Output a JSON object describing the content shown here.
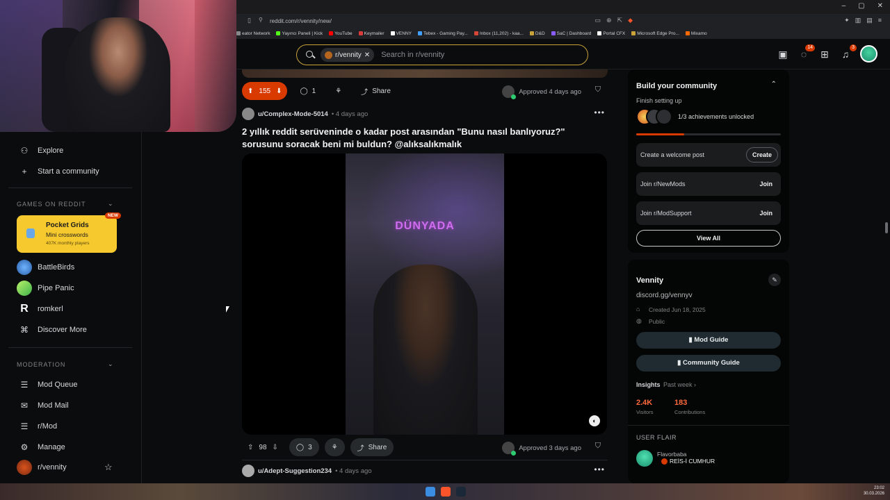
{
  "browser": {
    "url": "reddit.com/r/vennity/new/",
    "bookmarks": [
      "eator Network",
      "Yayıncı Paneli | Kick",
      "YouTube",
      "Keymailer",
      "VENNY",
      "Tebex - Gaming Pay...",
      "Inbox (11,202) - kaa...",
      "D&D",
      "SaC | Dashboard",
      "Portal CFX",
      "Microsoft Edge Pro...",
      "Mixamo"
    ],
    "bookmark_colors": [
      "#888888",
      "#53fc18",
      "#ff0000",
      "#d93a3a",
      "#ffffff",
      "#3fa0ff",
      "#d44638",
      "#c9a23a",
      "#8b5cf6",
      "#ffffff",
      "#c9a23a",
      "#ff6a00"
    ]
  },
  "header": {
    "chip_label": "r/vennity",
    "search_placeholder": "Search in r/vennity",
    "chat_badge": "14",
    "notif_badge": "3"
  },
  "sidebar": {
    "explore": "Explore",
    "start_community": "Start a community",
    "games_heading": "GAMES ON REDDIT",
    "featured_game": {
      "title": "Pocket Grids",
      "subtitle": "Mini crosswords",
      "users": "407K monthly players",
      "badge": "NEW"
    },
    "games": [
      {
        "label": "BattleBirds",
        "color": "#3a7bd5"
      },
      {
        "label": "Pipe Panic",
        "color": "#7ed957"
      },
      {
        "label": "romkerl",
        "color": "#ffffff"
      }
    ],
    "discover": "Discover More",
    "moderation_heading": "MODERATION",
    "mod_items": [
      "Mod Queue",
      "Mod Mail",
      "r/Mod",
      "Manage"
    ],
    "community": "r/vennity"
  },
  "feed": {
    "prev_post": {
      "votes": "155",
      "comments": "1",
      "share": "Share",
      "approved": "Approved 4 days ago"
    },
    "post": {
      "user": "u/Complex-Mode-5014",
      "time": "• 4 days ago",
      "title": "2 yıllık reddit serüveninde o kadar post arasından \"Bunu nasıl banlıyoruz?\" sorusunu soracak beni mi buldun? @alıksalıkmalık",
      "video_caption": "DÜNYADA",
      "votes": "98",
      "comments": "3",
      "share": "Share",
      "approved": "Approved 3 days ago"
    },
    "next_post": {
      "user": "u/Adept-Suggestion234",
      "time": "• 4 days ago"
    }
  },
  "right": {
    "build": {
      "title": "Build your community",
      "subtitle": "Finish setting up",
      "achievements": "1/3 achievements unlocked",
      "progress": 0.33,
      "tasks": [
        {
          "label": "Create a welcome post",
          "button": "Create"
        },
        {
          "label": "Join r/NewMods",
          "button": "Join"
        },
        {
          "label": "Join r/ModSupport",
          "button": "Join"
        }
      ],
      "view_all": "View All"
    },
    "about": {
      "name": "Vennity",
      "description": "discord.gg/vennyv",
      "created": "Created Jun 18, 2025",
      "visibility": "Public",
      "mod_guide": "Mod Guide",
      "community_guide": "Community Guide",
      "insights": "Insights",
      "period": "Past week",
      "visitors_value": "2.4K",
      "visitors_label": "Visitors",
      "contrib_value": "183",
      "contrib_label": "Contributions",
      "flair_heading": "USER FLAIR",
      "flair_user": "Flavorbaba",
      "flair_text": "REİS-İ CUMHUR"
    }
  },
  "taskbar": {
    "time": "23:02",
    "date": "30.03.2026"
  }
}
